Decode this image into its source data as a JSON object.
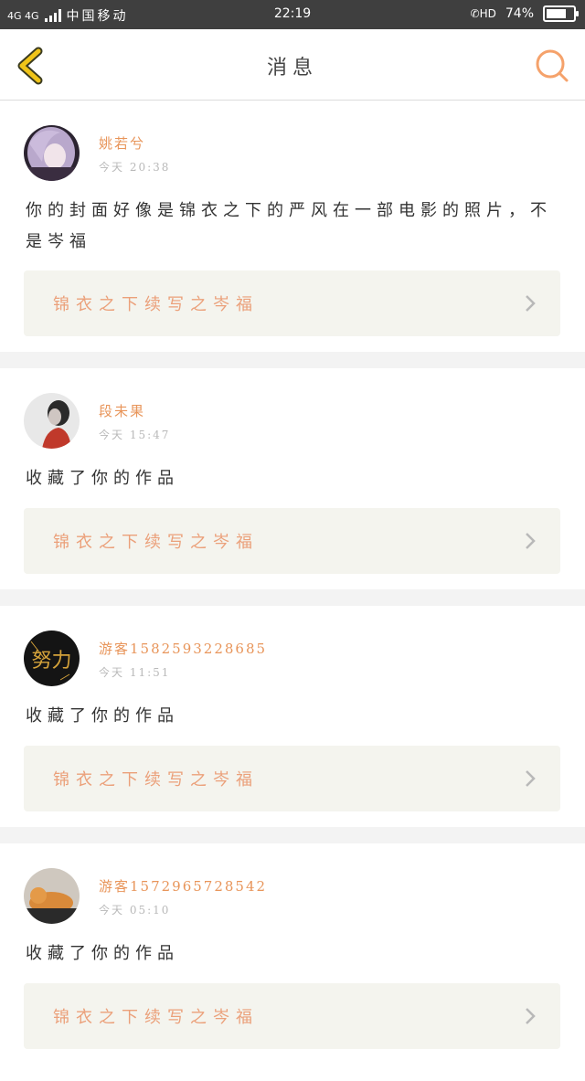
{
  "status_bar": {
    "network": "4G 4G",
    "carrier": "中国移动",
    "time": "22:19",
    "hd_label": "HD",
    "battery": "74%",
    "battery_level": 0.74
  },
  "header": {
    "title": "消息",
    "back_icon": "chevron-left-icon",
    "search_icon": "search-icon",
    "accent_back": "#f0c419",
    "accent_search": "#f5a26b"
  },
  "messages": [
    {
      "user": "姚若兮",
      "time": "今天 20:38",
      "text": "你的封面好像是锦衣之下的严风在一部电影的照片，不是岑福",
      "work": "锦衣之下续写之岑福",
      "avatar_icon": "avatar-purple-hair"
    },
    {
      "user": "段未果",
      "time": "今天 15:47",
      "text": "收藏了你的作品",
      "work": "锦衣之下续写之岑福",
      "avatar_icon": "avatar-gray-photo"
    },
    {
      "user": "游客1582593228685",
      "time": "今天 11:51",
      "text": "收藏了你的作品",
      "work": "锦衣之下续写之岑福",
      "avatar_icon": "avatar-gold-calligraphy",
      "avatar_text": "努力"
    },
    {
      "user": "游客1572965728542",
      "time": "今天 05:10",
      "text": "收藏了你的作品",
      "work": "锦衣之下续写之岑福",
      "avatar_icon": "avatar-cat-photo"
    }
  ]
}
